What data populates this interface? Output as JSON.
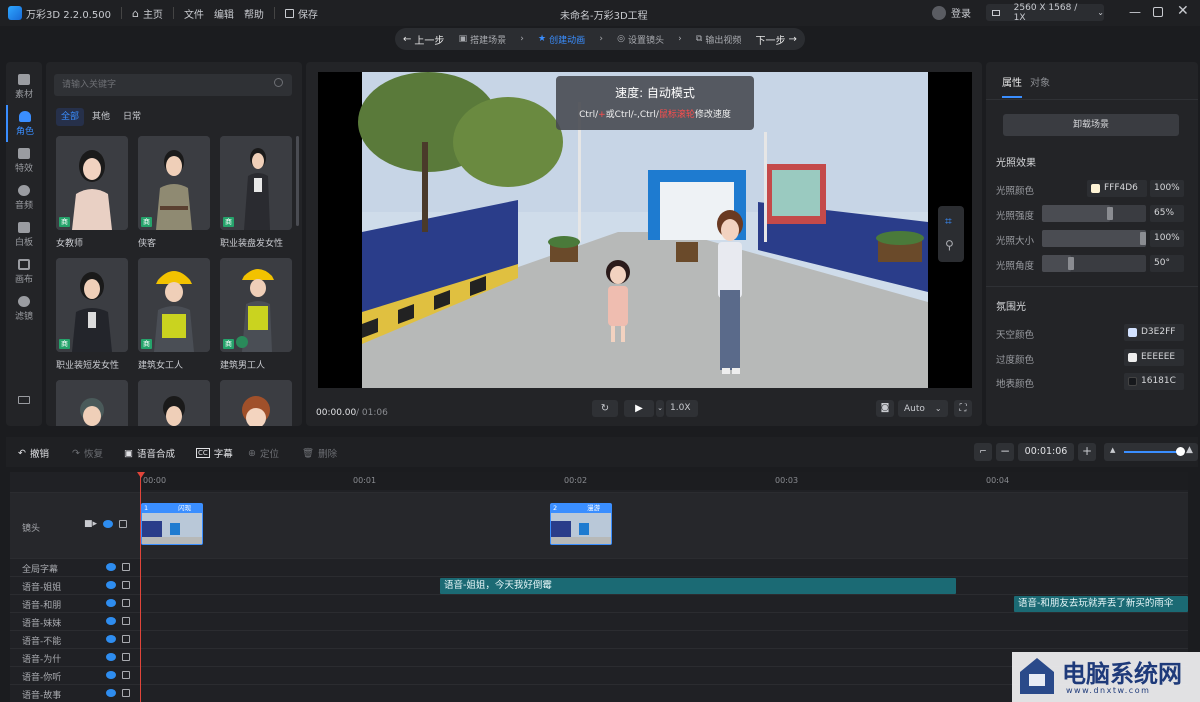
{
  "app": {
    "name": "万彩3D 2.2.0.500",
    "home": "主页",
    "menu": [
      "文件",
      "编辑",
      "帮助"
    ],
    "save": "保存",
    "project_title": "未命名-万彩3D工程",
    "login": "登录",
    "resolution": "2560 X 1568 / 1X"
  },
  "steps": {
    "prev": "上一步",
    "items": [
      {
        "label": "搭建场景",
        "active": false
      },
      {
        "label": "创建动画",
        "active": true
      },
      {
        "label": "设置镜头",
        "active": false
      },
      {
        "label": "输出视频",
        "active": false
      }
    ],
    "next": "下一步"
  },
  "rail": [
    {
      "label": "素材",
      "active": false
    },
    {
      "label": "角色",
      "active": true
    },
    {
      "label": "特效",
      "active": false
    },
    {
      "label": "音频",
      "active": false
    },
    {
      "label": "白板",
      "active": false
    },
    {
      "label": "画布",
      "active": false
    },
    {
      "label": "滤镜",
      "active": false
    }
  ],
  "assets": {
    "search_placeholder": "请输入关键字",
    "filters": [
      {
        "label": "全部",
        "active": true
      },
      {
        "label": "其他",
        "active": false
      },
      {
        "label": "日常",
        "active": false
      }
    ],
    "badge": "商",
    "cards": [
      {
        "label": "女教师"
      },
      {
        "label": "侠客"
      },
      {
        "label": "职业装盘发女性"
      },
      {
        "label": "职业装短发女性"
      },
      {
        "label": "建筑女工人"
      },
      {
        "label": "建筑男工人"
      },
      {
        "label": ""
      },
      {
        "label": ""
      },
      {
        "label": ""
      }
    ]
  },
  "viewport": {
    "tip_title": "速度: 自动模式",
    "tip_prefix": "Ctrl/",
    "tip_plus": "+",
    "tip_mid": "或Ctrl/",
    "tip_minus": "-",
    "tip_comma": ",Ctrl/",
    "tip_wheel": "鼠标滚轮",
    "tip_suffix": "修改速度",
    "time_current": "00:00.00",
    "time_total": "/ 01:06",
    "speed": "1.0X",
    "quality": "Auto"
  },
  "props": {
    "tabs": [
      {
        "label": "属性",
        "active": true
      },
      {
        "label": "对象",
        "active": false
      }
    ],
    "unload": "卸载场景",
    "lighting_title": "光照效果",
    "light_color_label": "光照颜色",
    "light_color": "FFF4D6",
    "light_color_pct": "100%",
    "light_intensity_label": "光照强度",
    "light_intensity": "65%",
    "light_intensity_frac": 0.65,
    "light_size_label": "光照大小",
    "light_size": "100%",
    "light_size_frac": 1.0,
    "light_angle_label": "光照角度",
    "light_angle": "50°",
    "light_angle_frac": 0.28,
    "ambient_title": "氛围光",
    "sky_label": "天空颜色",
    "sky_color": "D3E2FF",
    "trans_label": "过度颜色",
    "trans_color": "EEEEEE",
    "ground_label": "地表颜色",
    "ground_color": "16181C"
  },
  "timeline": {
    "undo": "撤销",
    "redo": "恢复",
    "tts": "语音合成",
    "subtitle": "字幕",
    "locate": "定位",
    "delete": "删除",
    "duration": "00:01:06",
    "ticks": [
      "00:00",
      "00:01",
      "00:02",
      "00:03",
      "00:04"
    ],
    "camera_track": "镜头",
    "camera_clips": [
      {
        "index": "1",
        "name": "闪现"
      },
      {
        "index": "2",
        "name": "漫游"
      }
    ],
    "tracks": [
      {
        "name": "全局字幕"
      },
      {
        "name": "语音-姐姐",
        "clip": "语音-姐姐，今天我好倒霉"
      },
      {
        "name": "语音-和朋",
        "clip": "语音-和朋友去玩就弄丢了新买的雨伞"
      },
      {
        "name": "语音-妹妹"
      },
      {
        "name": "语音-不能"
      },
      {
        "name": "语音-为什"
      },
      {
        "name": "语音-你听"
      },
      {
        "name": "语音-故事"
      }
    ]
  },
  "watermark": {
    "text": "电脑系统网",
    "url": "www.dnxtw.com"
  },
  "colors": {
    "accent": "#3a8eff",
    "clip": "#1b6a74",
    "badge": "#25a36b",
    "playhead": "#e0453a"
  }
}
